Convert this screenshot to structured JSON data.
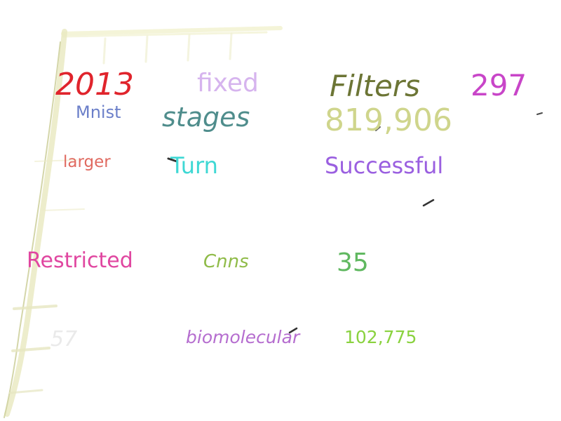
{
  "words": {
    "w2013": "2013",
    "fixed": "fixed",
    "filters": "Filters",
    "n297": "297",
    "mnist": "Mnist",
    "stages": "stages",
    "n819906": "819,906",
    "larger": "larger",
    "turn": "Turn",
    "successful": "Successful",
    "restricted": "Restricted",
    "cnns": "Cnns",
    "n35": "35",
    "n57": "57",
    "biomolecular": "biomolecular",
    "n102775": "102,775"
  },
  "colors": {
    "w2013": "#e0242c",
    "fixed": "#d6b4ee",
    "filters": "#6c7535",
    "n297": "#c845c8",
    "mnist": "#6b7fc9",
    "stages": "#4f8d8c",
    "n819906": "#cfd58c",
    "larger": "#e06a60",
    "turn": "#3ed8d4",
    "successful": "#9a5fe0",
    "restricted": "#e046a0",
    "cnns": "#8fbb48",
    "n35": "#60b860",
    "n57": "#eaeaea",
    "biomolecular": "#b56dcf",
    "n102775": "#8ad23f"
  }
}
